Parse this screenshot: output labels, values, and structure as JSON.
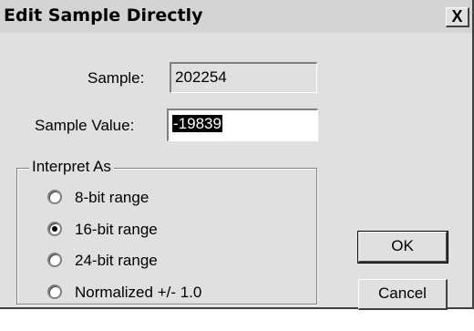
{
  "window": {
    "title": "Edit Sample Directly",
    "close_label": "X"
  },
  "sample": {
    "label": "Sample:",
    "value": "202254"
  },
  "sample_value": {
    "label": "Sample Value:",
    "value": "-19839"
  },
  "interpret": {
    "legend": "Interpret As",
    "options": [
      {
        "label": "8-bit range",
        "selected": false
      },
      {
        "label": "16-bit range",
        "selected": true
      },
      {
        "label": "24-bit range",
        "selected": false
      },
      {
        "label": "Normalized +/- 1.0",
        "selected": false
      }
    ]
  },
  "buttons": {
    "ok": "OK",
    "cancel": "Cancel"
  }
}
